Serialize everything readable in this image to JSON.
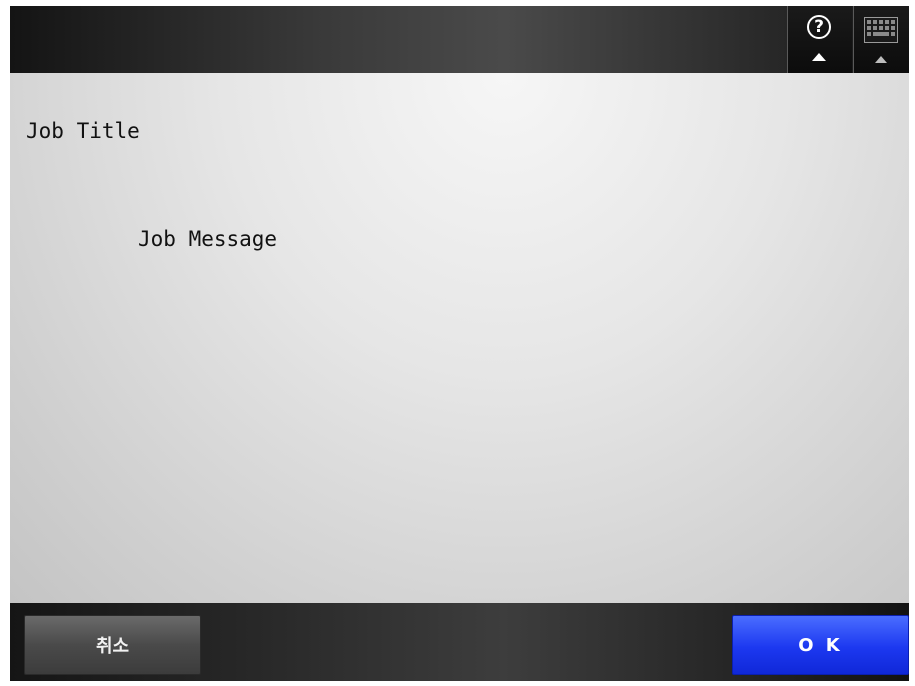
{
  "header": {
    "help_glyph": "?",
    "help_icon": "help-question-icon",
    "keyboard_icon": "keyboard-icon"
  },
  "content": {
    "title": "Job Title",
    "message": "Job Message"
  },
  "footer": {
    "cancel_label": "취소",
    "ok_label": "O K"
  },
  "colors": {
    "ok_button": "#1c38f0",
    "cancel_button": "#4a4a4a",
    "header_bg": "#2e2e2e"
  }
}
